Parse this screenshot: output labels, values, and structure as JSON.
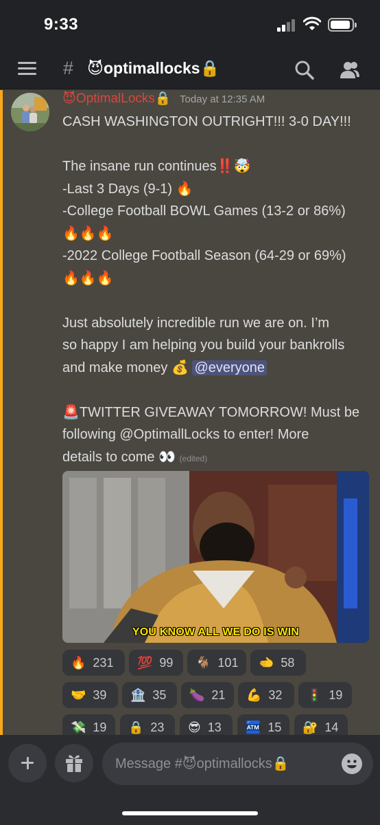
{
  "status_bar": {
    "time": "9:33"
  },
  "nav": {
    "channel_hash": "#",
    "channel_emoji": "😈",
    "channel_name": "optimallocks",
    "channel_lock": "🔒"
  },
  "message": {
    "author_emoji": "😈",
    "author": "OptimalLocks",
    "author_lock": "🔒",
    "timestamp": "Today at 12:35 AM",
    "line1": "CASH WASHINGTON OUTRIGHT!!! 3-0 DAY!!!",
    "line2": "The insane run continues‼️🤯",
    "line3": "-Last 3 Days (9-1) 🔥",
    "line4": "-College Football BOWL Games (13-2 or 86%)",
    "line5": "🔥🔥🔥",
    "line6": "-2022 College Football Season (64-29 or 69%)",
    "line7": "🔥🔥🔥",
    "line8": "Just absolutely incredible run we are on. I’m",
    "line9": "so happy I am helping you build your bankrolls",
    "line10": "and make money 💰 ",
    "mention": "@everyone",
    "line11": "🚨TWITTER GIVEAWAY TOMORROW! Must be",
    "line12": "following @OptimallLocks to enter! More",
    "line13": "details to come 👀 ",
    "edited": "(edited)",
    "gif_caption": "YOU KNOW ALL WE DO IS WIN"
  },
  "reactions": [
    {
      "emoji": "🔥",
      "count": "231"
    },
    {
      "emoji": "💯",
      "count": "99"
    },
    {
      "emoji": "🐐",
      "count": "101"
    },
    {
      "emoji": "🫲",
      "count": "58"
    },
    {
      "emoji": "🤝",
      "count": "39"
    },
    {
      "emoji": "🏦",
      "count": "35"
    },
    {
      "emoji": "🍆",
      "count": "21"
    },
    {
      "emoji": "💪",
      "count": "32"
    },
    {
      "emoji": "🚦",
      "count": "19"
    },
    {
      "emoji": "💸",
      "count": "19"
    },
    {
      "emoji": "🔒",
      "count": "23"
    },
    {
      "emoji": "😎",
      "count": "13"
    },
    {
      "emoji": "🏧",
      "count": "15"
    },
    {
      "emoji": "🔐",
      "count": "14"
    }
  ],
  "input": {
    "placeholder": "Message #😈optimallocks🔒"
  },
  "icons": {
    "menu": "hamburger-menu-icon",
    "search": "search-icon",
    "members": "members-icon",
    "add": "plus-icon",
    "gift": "gift-icon",
    "emoji": "emoji-icon"
  },
  "colors": {
    "author": "#d9463f",
    "mention_highlight": "#faa81a",
    "mention_bg": "#4e5479",
    "caption": "#ffe600"
  }
}
